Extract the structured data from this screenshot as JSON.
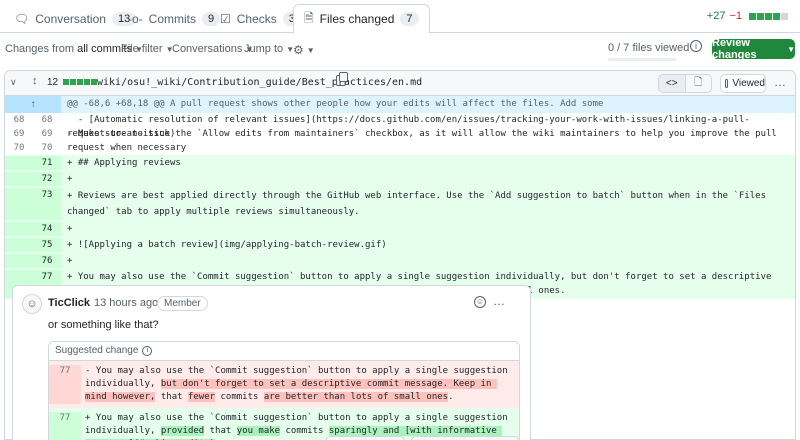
{
  "tabs": [
    {
      "label": "Conversation",
      "count": "13",
      "icon": "comment-icon"
    },
    {
      "label": "Commits",
      "count": "9",
      "icon": "commit-icon"
    },
    {
      "label": "Checks",
      "count": "3",
      "icon": "checks-icon"
    },
    {
      "label": "Files changed",
      "count": "7",
      "icon": "file-diff-icon",
      "selected": true
    }
  ],
  "diffstat": {
    "additions": "+27",
    "deletions": "−1"
  },
  "toolbar": {
    "changes_from_prefix": "Changes from",
    "changes_from_value": "all commits",
    "file_filter": "File filter",
    "conversations": "Conversations",
    "jump_to": "Jump to",
    "files_viewed": "0 / 7 files viewed",
    "review_button": "Review changes"
  },
  "file": {
    "changed_lines": "12",
    "path": "wiki/osu!_wiki/Contribution_guide/Best_practices/en.md",
    "viewed_label": "Viewed"
  },
  "diff": {
    "hunk": "@@ -68,6 +68,18 @@ A pull request shows other people how your edits will affect the files. Add some",
    "context": [
      {
        "old": "68",
        "new": "68",
        "text": "  - [Automatic resolution of relevant issues](https://docs.github.com/en/issues/tracking-your-work-with-issues/linking-a-pull-request-to-an-issue)"
      },
      {
        "old": "69",
        "new": "69",
        "text": "- Make sure to tick the `Allow edits from maintainers` checkbox, as it will allow the wiki maintainers to help you improve the pull request when necessary"
      },
      {
        "old": "70",
        "new": "70",
        "text": ""
      }
    ],
    "added": [
      {
        "new": "71",
        "text": "+ ## Applying reviews"
      },
      {
        "new": "72",
        "text": "+"
      },
      {
        "new": "73",
        "text": "+ Reviews are best applied directly through the GitHub web interface. Use the `Add suggestion to batch` button when in the `Files changed` tab to apply multiple reviews simultaneously."
      },
      {
        "new": "74",
        "text": "+"
      },
      {
        "new": "75",
        "text": "+ ![Applying a batch review](img/applying-batch-review.gif)"
      },
      {
        "new": "76",
        "text": "+"
      },
      {
        "new": "77",
        "text": "+ You may also use the `Commit suggestion` button to apply a single suggestion individually, but don't forget to set a descriptive commit message. Keep in mind however, that fewer commits are better than lots of small ones."
      }
    ]
  },
  "comment": {
    "author": "TicClick",
    "time": "13 hours ago",
    "role": "Member",
    "body": "or something like that?",
    "suggested_label": "Suggested change",
    "old_line": "77",
    "new_line": "77",
    "old_parts": [
      {
        "t": "- You may also use the `Commit suggestion` button to apply a single suggestion individually, ",
        "h": false
      },
      {
        "t": "but don't forget to set a descriptive commit message. Keep in mind however,",
        "h": true
      },
      {
        "t": " that ",
        "h": false
      },
      {
        "t": "fewer",
        "h": true
      },
      {
        "t": " commits ",
        "h": false
      },
      {
        "t": "are better than lots of small ones",
        "h": true
      },
      {
        "t": ".",
        "h": false
      }
    ],
    "new_parts": [
      {
        "t": "+ You may also use the `Commit suggestion` button to apply a single suggestion individually, ",
        "h": false
      },
      {
        "t": "provided",
        "h": true
      },
      {
        "t": " that ",
        "h": false
      },
      {
        "t": "you make",
        "h": true
      },
      {
        "t": " commits ",
        "h": false
      },
      {
        "t": "sparingly and [with informative messages](#making-edits)",
        "h": true
      },
      {
        "t": ".",
        "h": false
      }
    ]
  },
  "colors": {
    "accent_green": "#1f883d",
    "add_bg": "#e6ffec",
    "del_bg": "#ffebe9",
    "hunk_bg": "#ddf4ff"
  }
}
